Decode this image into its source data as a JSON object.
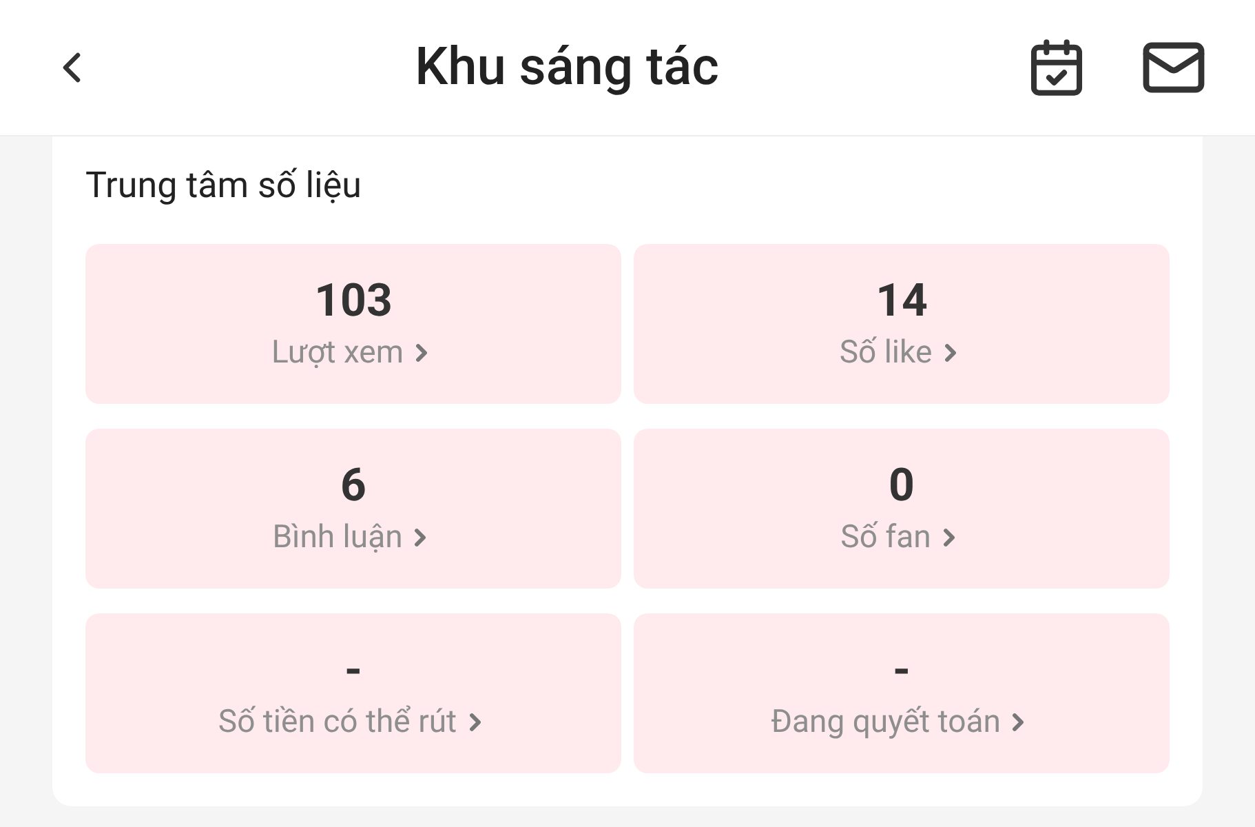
{
  "header": {
    "title": "Khu sáng tác"
  },
  "data_center": {
    "title": "Trung tâm số liệu",
    "stats": [
      {
        "value": "103",
        "label": "Lượt xem"
      },
      {
        "value": "14",
        "label": "Số like"
      },
      {
        "value": "6",
        "label": "Bình luận"
      },
      {
        "value": "0",
        "label": "Số fan"
      },
      {
        "value": "-",
        "label": "Số tiền có thể rút"
      },
      {
        "value": "-",
        "label": "Đang quyết toán"
      }
    ]
  }
}
